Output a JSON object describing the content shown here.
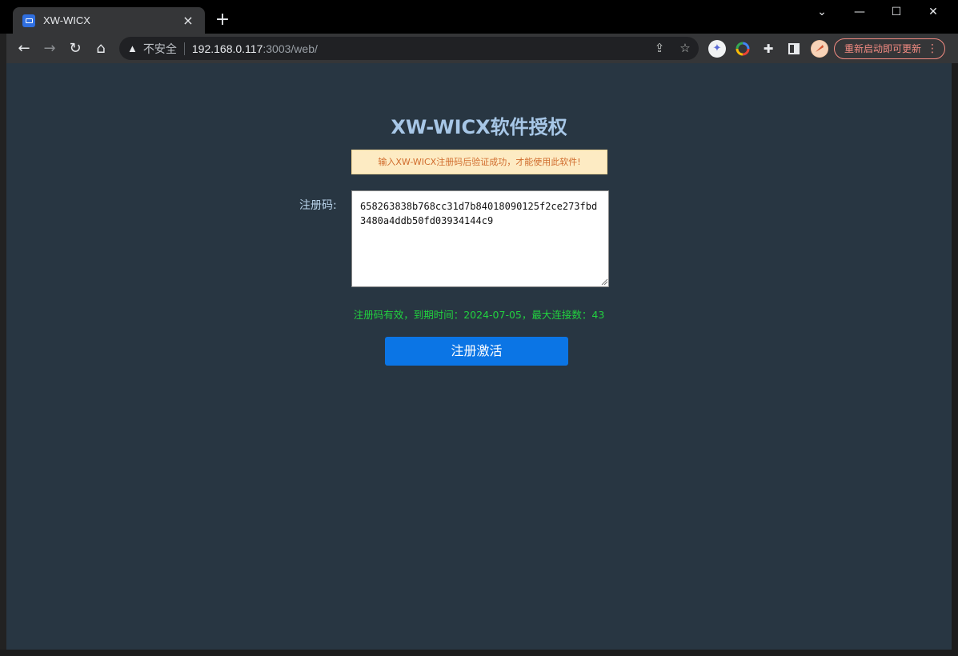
{
  "browser": {
    "tab_title": "XW-WICX",
    "tab_close": "×",
    "new_tab": "+",
    "window_controls": {
      "dropdown": "⌄",
      "minimize": "—",
      "maximize": "☐",
      "close": "✕"
    },
    "nav": {
      "back": "←",
      "forward": "→",
      "reload": "↻",
      "home": "⌂"
    },
    "address": {
      "security_label": "不安全",
      "host": "192.168.0.117",
      "path": ":3003/web/"
    },
    "update_button_label": "重新启动即可更新",
    "menu": "⋮",
    "icons": [
      "share-icon",
      "bookmark-star-icon",
      "extension-feather-icon",
      "extension-color-wheel-icon",
      "extensions-puzzle-icon",
      "side-panel-icon",
      "profile-avatar-icon"
    ]
  },
  "page": {
    "title": "XW-WICX软件授权",
    "notice": "输入XW-WICX注册码后验证成功，才能使用此软件!",
    "code_label": "注册码:",
    "code_value": "658263838b768cc31d7b84018090125f2ce273fbd3480a4ddb50fd03934144c9",
    "status": "注册码有效，到期时间：2024-07-05，最大连接数：43",
    "activate_label": "注册激活"
  },
  "colors": {
    "page_bg": "#283642",
    "title": "#a7c7e7",
    "notice_bg": "#fdebc3",
    "notice_text": "#d06b2c",
    "status_ok": "#22d13f",
    "button_bg": "#0b75e5"
  }
}
